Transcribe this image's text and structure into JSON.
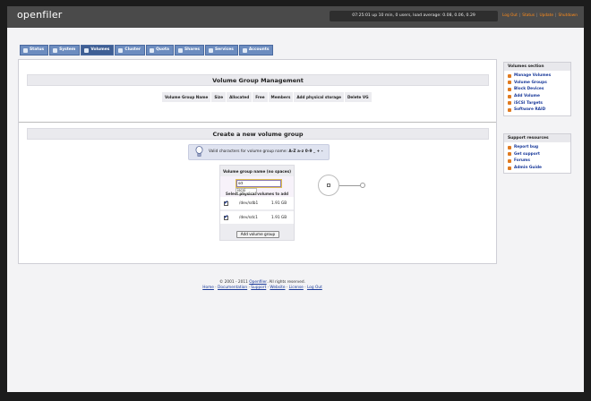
{
  "header": {
    "logo": "openfiler",
    "status": "07:25:01 up 10 min, 0 users, load average: 0.08, 0.06, 0.29",
    "links": [
      "Log Out",
      "Status",
      "Update",
      "Shutdown"
    ]
  },
  "tabs": [
    {
      "label": "Status",
      "icon": "status-icon"
    },
    {
      "label": "System",
      "icon": "system-icon"
    },
    {
      "label": "Volumes",
      "icon": "volumes-icon",
      "active": true
    },
    {
      "label": "Cluster",
      "icon": "cluster-icon"
    },
    {
      "label": "Quota",
      "icon": "quota-icon"
    },
    {
      "label": "Shares",
      "icon": "shares-icon"
    },
    {
      "label": "Services",
      "icon": "services-icon"
    },
    {
      "label": "Accounts",
      "icon": "accounts-icon"
    }
  ],
  "vg_management": {
    "title": "Volume Group Management",
    "columns": [
      "Volume Group Name",
      "Size",
      "Allocated",
      "Free",
      "Members",
      "Add physical storage",
      "Delete VG"
    ]
  },
  "create": {
    "title": "Create a new volume group",
    "hint_text": "Valid characters for volume group name: ",
    "hint_chars": "A-Z a-z 0-9 _ + -",
    "name_label": "Volume group name (no spaces)",
    "name_value": "sd",
    "suggestion": "iscsi",
    "select_label": "Select physical volumes to add",
    "devices": [
      {
        "device": "/dev/sdb1",
        "size": "1.91 GB",
        "checked": true
      },
      {
        "device": "/dev/sdc1",
        "size": "1.91 GB",
        "checked": true
      }
    ],
    "add_button": "Add volume group"
  },
  "sidebar": {
    "volumes": {
      "title": "Volumes section",
      "items": [
        "Manage Volumes",
        "Volume Groups",
        "Block Devices",
        "Add Volume",
        "iSCSI Targets",
        "Software RAID"
      ]
    },
    "support": {
      "title": "Support resources",
      "items": [
        "Report bug",
        "Get support",
        "Forums",
        "Admin Guide"
      ]
    }
  },
  "footer": {
    "copyright_pre": "© 2001 - 2011 ",
    "copyright_link": "Openfiler",
    "copyright_post": ". All rights reserved.",
    "links": [
      "Home",
      "Documentation",
      "Support",
      "Website",
      "License",
      "Log Out"
    ]
  }
}
